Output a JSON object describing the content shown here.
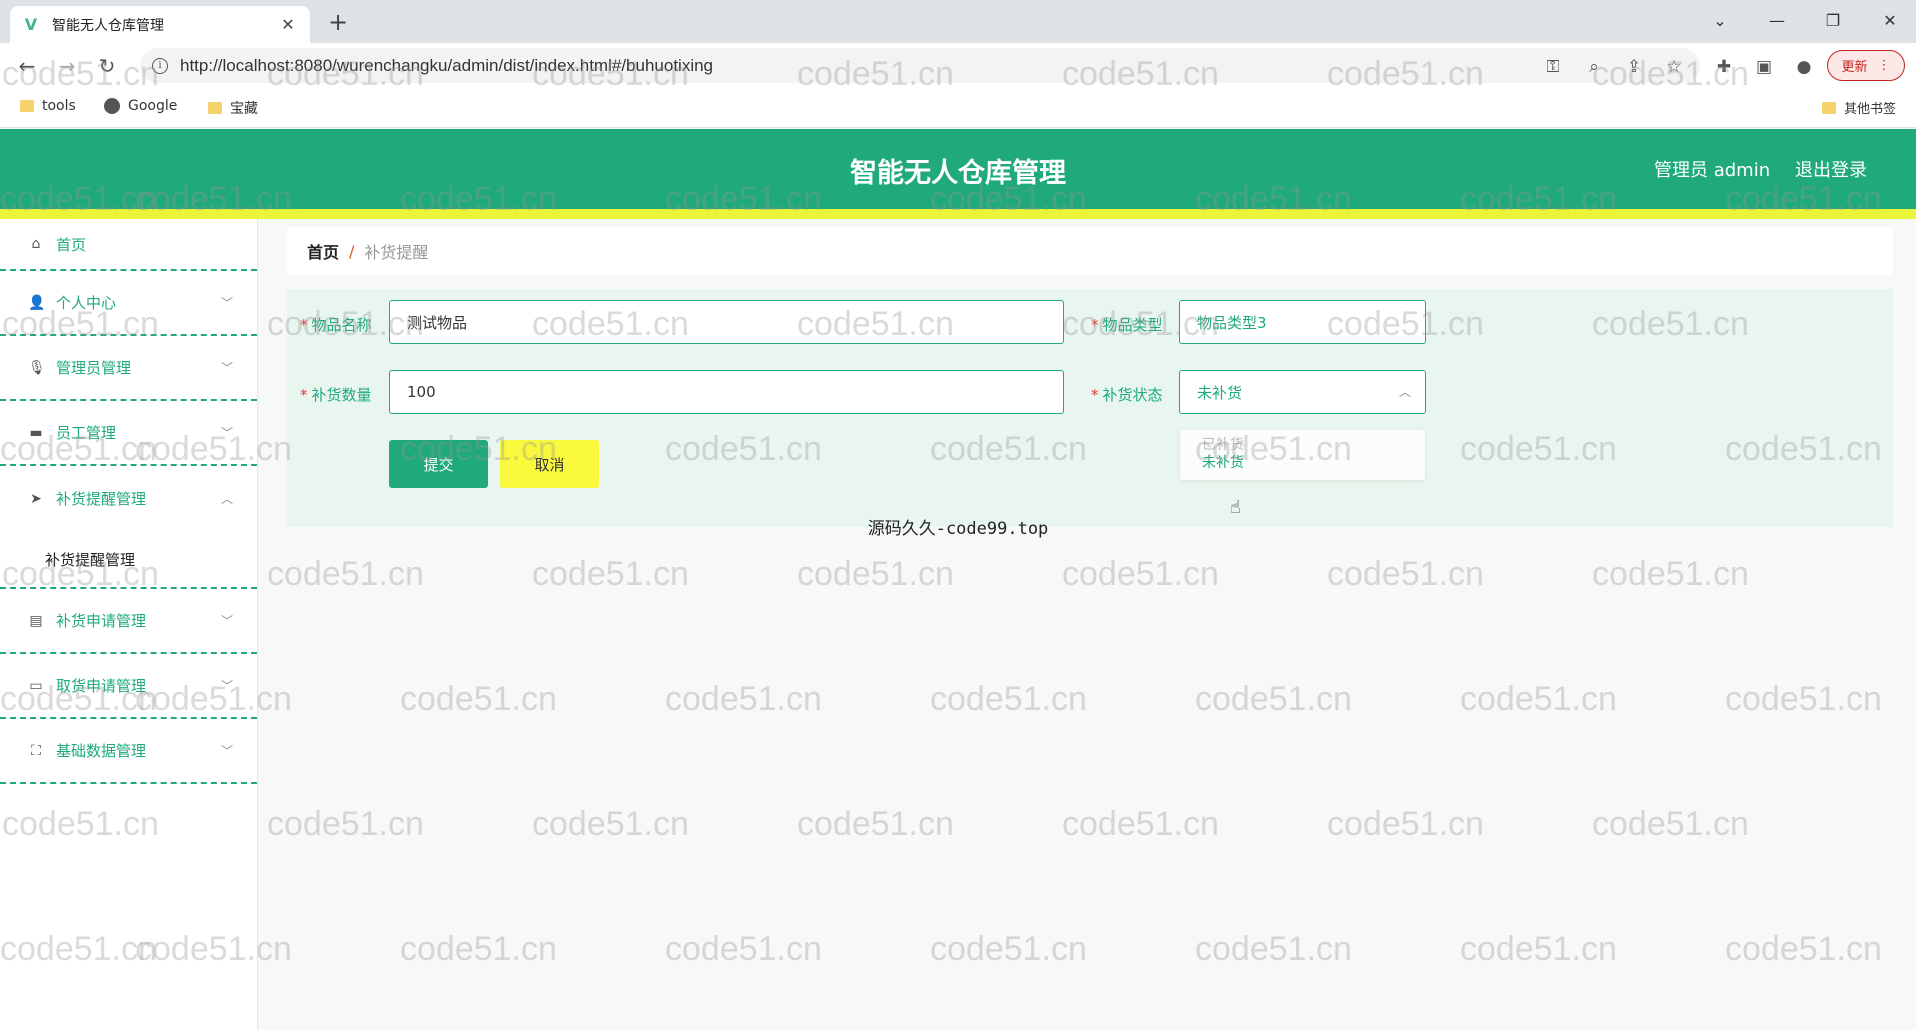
{
  "browser": {
    "tab_title": "智能无人仓库管理",
    "tab_favicon": "V",
    "url": "http://localhost:8080/wurenchangku/admin/dist/index.html#/buhuotixing",
    "update_label": "更新",
    "bookmarks": [
      {
        "label": "tools",
        "icon": "folder-icon"
      },
      {
        "label": "Google",
        "icon": "globe-icon"
      },
      {
        "label": "宝藏",
        "icon": "folder-icon"
      }
    ],
    "other_bookmarks": "其他书签"
  },
  "header": {
    "title": "智能无人仓库管理",
    "user_label": "管理员 admin",
    "logout_label": "退出登录"
  },
  "sidebar": {
    "items": [
      {
        "label": "首页",
        "icon": "home-icon"
      },
      {
        "label": "个人中心",
        "icon": "user-icon"
      },
      {
        "label": "管理员管理",
        "icon": "mic-icon"
      },
      {
        "label": "员工管理",
        "icon": "chat-icon"
      },
      {
        "label": "补货提醒管理",
        "icon": "send-icon"
      },
      {
        "label": "补货申请管理",
        "icon": "briefcase-icon"
      },
      {
        "label": "取货申请管理",
        "icon": "message-icon"
      },
      {
        "label": "基础数据管理",
        "icon": "fullscreen-icon"
      }
    ],
    "submenu_label": "补货提醒管理"
  },
  "breadcrumb": {
    "home": "首页",
    "separator": "/",
    "current": "补货提醒"
  },
  "form": {
    "item_name_label": "物品名称",
    "item_name_value": "测试物品",
    "item_type_label": "物品类型",
    "item_type_value": "物品类型3",
    "quantity_label": "补货数量",
    "quantity_value": "100",
    "status_label": "补货状态",
    "status_value": "未补货",
    "status_options": [
      "已补货",
      "未补货"
    ],
    "submit_label": "提交",
    "cancel_label": "取消",
    "required_mark": "*"
  },
  "footer_note": "源码久久-code99.top",
  "watermark": "code51.cn",
  "colors": {
    "primary": "#1fa97c",
    "accent_yellow": "#eaf53a",
    "panel_bg": "#e8f6ef"
  }
}
